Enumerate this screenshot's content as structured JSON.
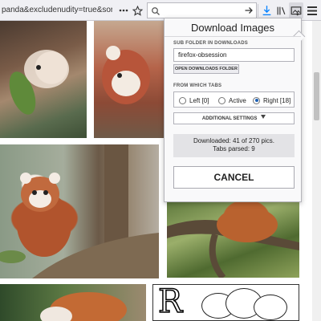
{
  "browser": {
    "url_text": "panda&excludenudity=true&sort=bi",
    "icons": {
      "reader_view": "reader-view-icon",
      "bookmark": "star-icon",
      "search": "search-icon",
      "go": "arrow-right-icon",
      "download": "download-icon",
      "library": "library-icon",
      "extension": "image-download-extension-icon",
      "menu": "hamburger-menu-icon"
    },
    "accent_color": "#0a84ff"
  },
  "popup": {
    "title": "Download Images",
    "subfolder_label": "SUB FOLDER IN DOWNLOADS",
    "subfolder_value": "firefox-obsession",
    "open_downloads_label": "OPEN DOWNLOADS FOLDER",
    "tabs_label": "FROM WHICH TABS",
    "tab_options": [
      {
        "label": "Left [0]",
        "selected": false
      },
      {
        "label": "Active",
        "selected": false
      },
      {
        "label": "Right [18]",
        "selected": true
      }
    ],
    "additional_settings_label": "ADDITIONAL SETTINGS",
    "additional_settings_icon": "triangle-down-icon",
    "status_line1": "Downloaded: 41 of 270 pics.",
    "status_line2": "Tabs parsed: 9",
    "cancel_label": "CANCEL"
  },
  "page": {
    "photos": [
      {
        "name": "red-panda-eating-leaves-photo"
      },
      {
        "name": "red-panda-closeup-photo"
      },
      {
        "name": "red-panda-on-branch-photo"
      },
      {
        "name": "red-panda-in-tree-photo"
      },
      {
        "name": "red-panda-lying-photo"
      },
      {
        "name": "red-panda-coloring-page"
      }
    ],
    "coloring_letter": "R"
  }
}
